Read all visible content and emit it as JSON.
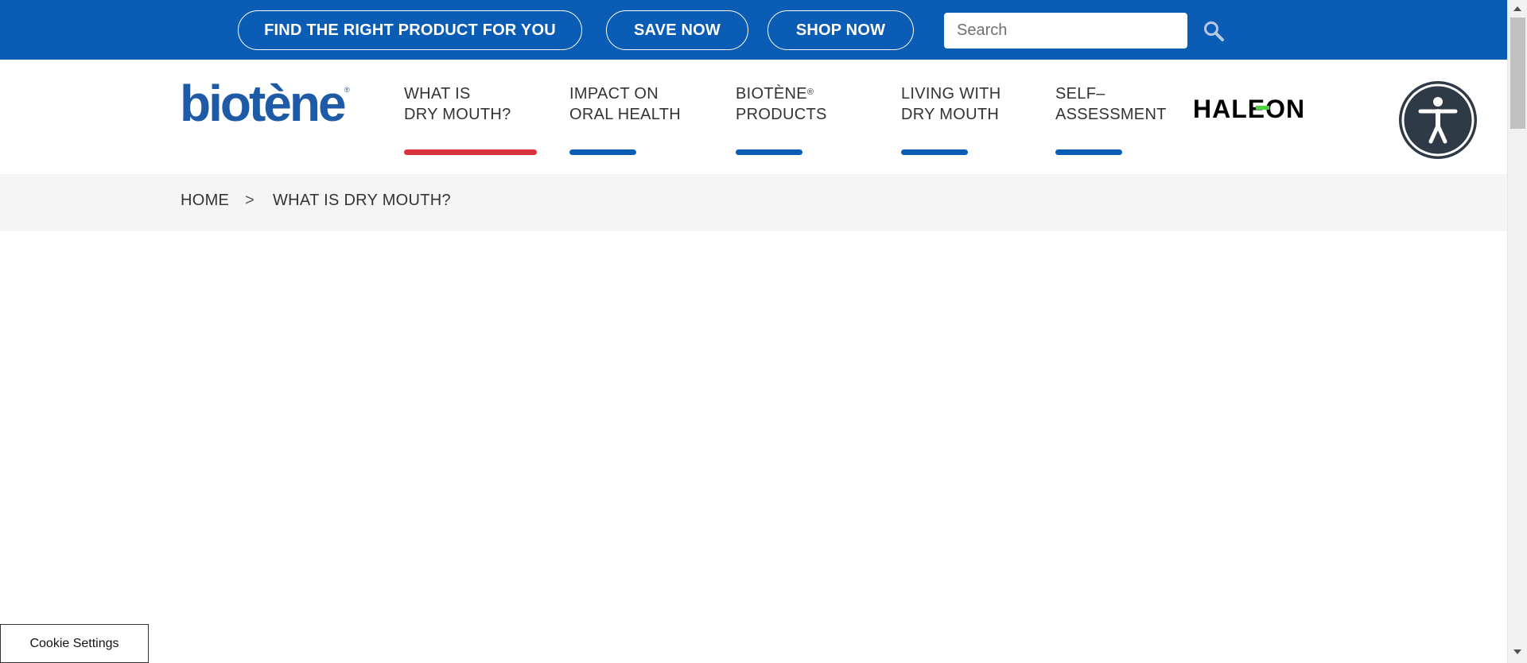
{
  "topbar": {
    "find_label": "FIND THE RIGHT PRODUCT FOR YOU",
    "save_label": "SAVE NOW",
    "shop_label": "SHOP NOW",
    "search_placeholder": "Search",
    "search_value": "",
    "search_icon": "magnifier-icon",
    "bg_color": "#0b5cb5"
  },
  "brand": {
    "logo_text": "biotène",
    "logo_mark": "®",
    "partner_logo_text": "HALEON",
    "logo_color": "#1f4e9c",
    "partner_accent_color": "#4cd23a"
  },
  "nav": {
    "items": [
      {
        "label": "WHAT IS\nDRY MOUTH?",
        "active": true
      },
      {
        "label": "IMPACT ON\nORAL HEALTH",
        "active": false
      },
      {
        "label": "BIOTÈNE",
        "label_sup": "®",
        "label_line2": "PRODUCTS",
        "active": false
      },
      {
        "label": "LIVING WITH\nDRY MOUTH",
        "active": false
      },
      {
        "label": "SELF–\nASSESSMENT",
        "active": false
      }
    ],
    "active_color": "#d8333a",
    "underline_color": "#0b5cb5"
  },
  "accessibility": {
    "icon": "accessibility-icon"
  },
  "breadcrumb": {
    "home": "HOME",
    "separator": ">",
    "current": "WHAT IS DRY MOUTH?"
  },
  "cookie": {
    "label": "Cookie Settings"
  }
}
